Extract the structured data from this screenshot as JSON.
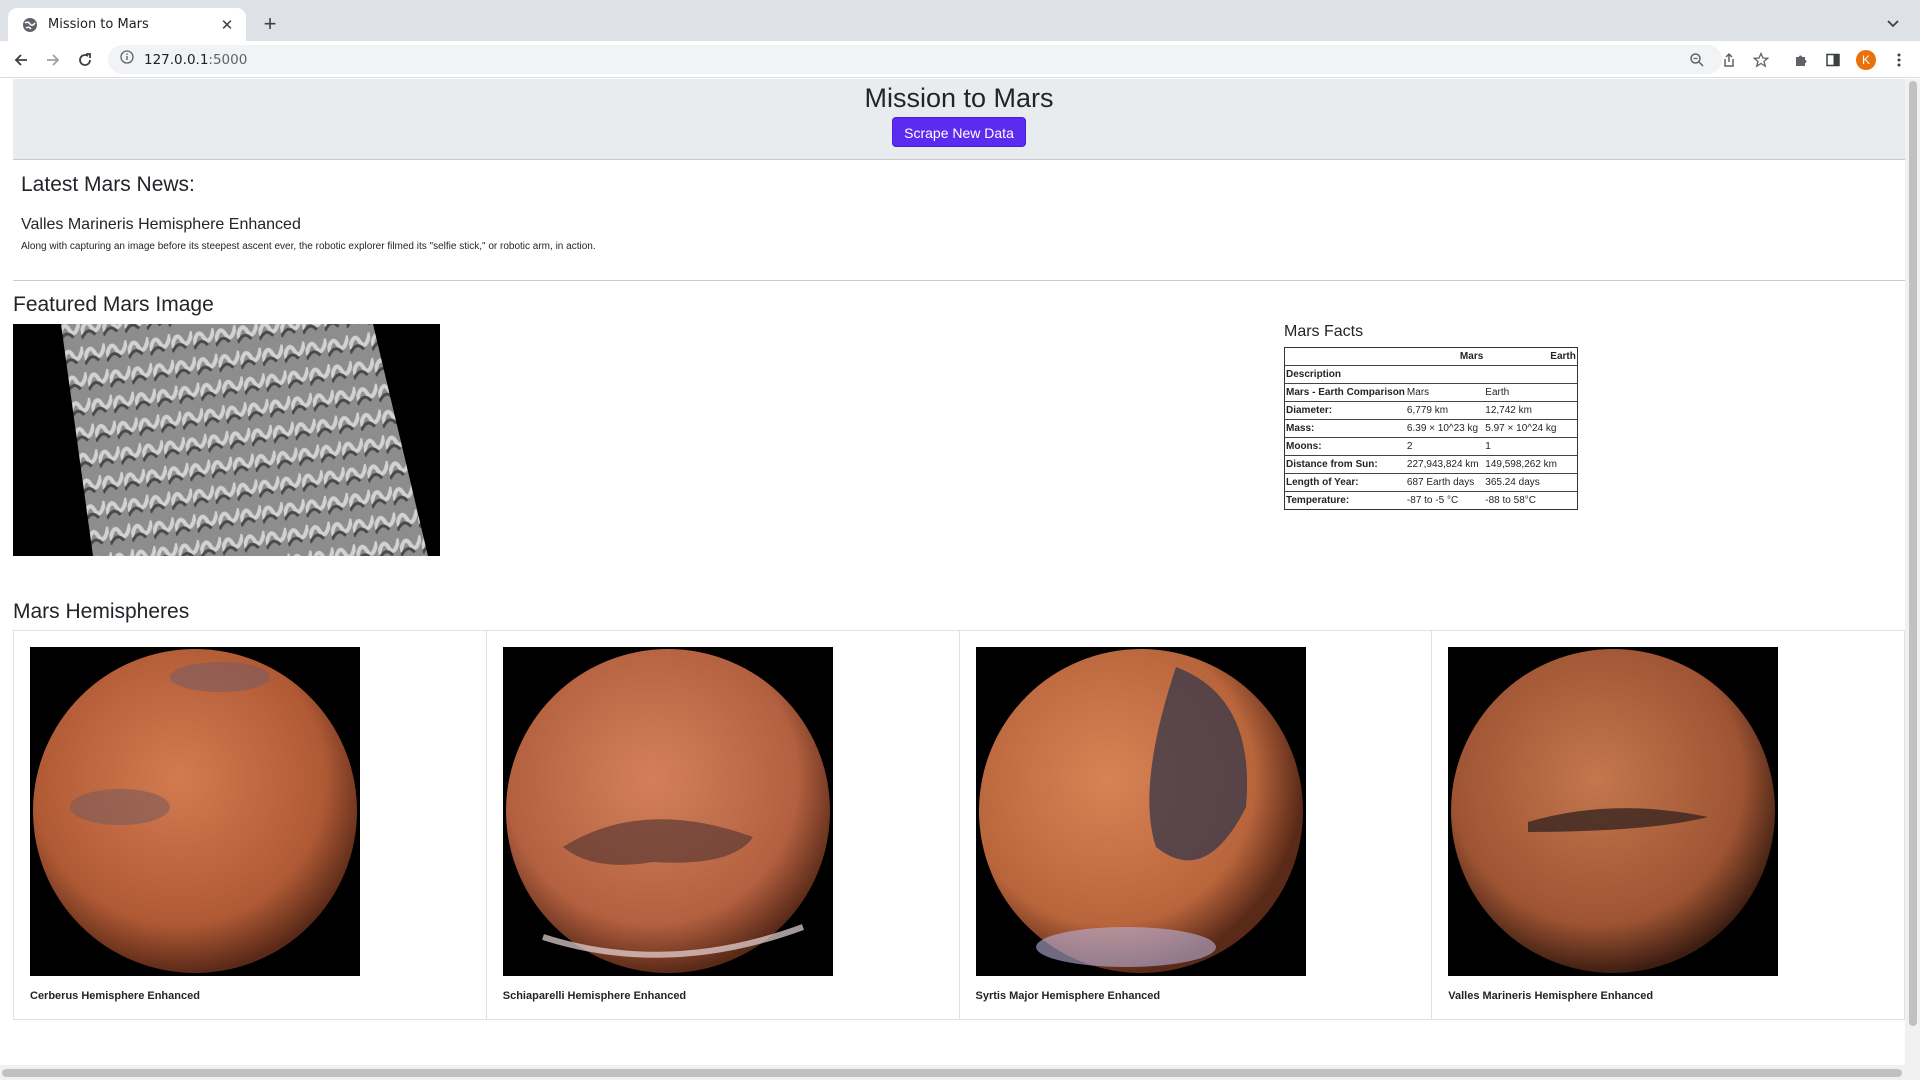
{
  "browser": {
    "tab_title": "Mission to Mars",
    "url_host": "127.0.0.1",
    "url_port": ":5000",
    "profile_initial": "K"
  },
  "header": {
    "title": "Mission to Mars",
    "scrape_button": "Scrape New Data"
  },
  "news": {
    "heading": "Latest Mars News:",
    "title": "Valles Marineris Hemisphere Enhanced",
    "paragraph": "Along with capturing an image before its steepest ascent ever, the robotic explorer filmed its \"selfie stick,\" or robotic arm, in action."
  },
  "featured": {
    "heading": "Featured Mars Image"
  },
  "facts": {
    "heading": "Mars Facts",
    "columns": [
      "",
      "Mars",
      "Earth"
    ],
    "rows": [
      [
        "Description",
        "",
        ""
      ],
      [
        "Mars - Earth Comparison",
        "Mars",
        "Earth"
      ],
      [
        "Diameter:",
        "6,779 km",
        "12,742 km"
      ],
      [
        "Mass:",
        "6.39 × 10^23 kg",
        "5.97 × 10^24 kg"
      ],
      [
        "Moons:",
        "2",
        "1"
      ],
      [
        "Distance from Sun:",
        "227,943,824 km",
        "149,598,262 km"
      ],
      [
        "Length of Year:",
        "687 Earth days",
        "365.24 days"
      ],
      [
        "Temperature:",
        "-87 to -5 °C",
        "-88 to 58°C"
      ]
    ]
  },
  "hemispheres": {
    "heading": "Mars Hemispheres",
    "items": [
      {
        "title": "Cerberus Hemisphere Enhanced"
      },
      {
        "title": "Schiaparelli Hemisphere Enhanced"
      },
      {
        "title": "Syrtis Major Hemisphere Enhanced"
      },
      {
        "title": "Valles Marineris Hemisphere Enhanced"
      }
    ]
  },
  "colors": {
    "button": "#5b2bf0",
    "jumbotron": "#e9ecef",
    "mars": "#c0613a"
  }
}
